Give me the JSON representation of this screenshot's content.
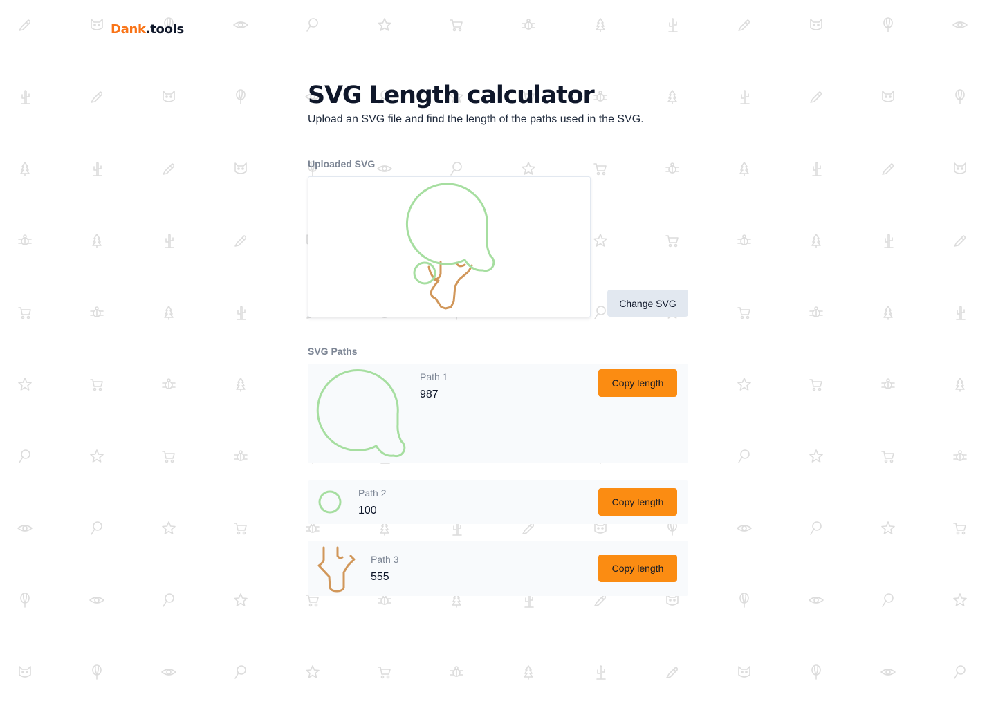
{
  "logo": {
    "brand": "Dank",
    "tld": ".tools"
  },
  "page": {
    "title": "SVG Length calculator",
    "subtitle": "Upload an SVG file and find the length of the paths used in the SVG."
  },
  "uploaded": {
    "label": "Uploaded SVG",
    "change_button": "Change SVG"
  },
  "paths_section": {
    "label": "SVG Paths",
    "copy_label": "Copy length",
    "items": [
      {
        "name": "Path 1",
        "length": "987",
        "color": "#a6dea0"
      },
      {
        "name": "Path 2",
        "length": "100",
        "color": "#a6dea0"
      },
      {
        "name": "Path 3",
        "length": "555",
        "color": "#d1975a"
      }
    ]
  },
  "background": {
    "icon_color": "#dcdcdc",
    "icons": [
      "pen-icon",
      "eye-icon",
      "cart-icon",
      "cactus-icon",
      "balloon-icon",
      "star-icon",
      "tree-icon",
      "cat-icon",
      "pin-icon",
      "bug-icon"
    ]
  }
}
